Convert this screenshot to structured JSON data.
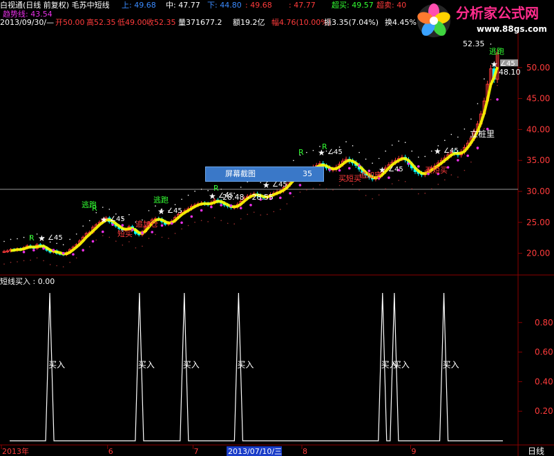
{
  "header": {
    "row1": [
      {
        "text": "白视通(日线 前复权) 毛苏中短线",
        "color": "#ffffff"
      },
      {
        "text": "上: 49.68",
        "color": "#3b8bff"
      },
      {
        "text": "中: 47.77",
        "color": "#ffffff"
      },
      {
        "text": "下: 44.80",
        "color": "#3b8bff"
      },
      {
        "text": ": 49.68",
        "color": "#ff3b3b"
      },
      {
        "text": ": 47.77",
        "color": "#ff3b3b"
      },
      {
        "text": "超买: 49.57",
        "color": "#33ff33"
      },
      {
        "text": "超卖: 40",
        "color": "#ff3b3b"
      }
    ],
    "trend_label": "趋势线: 43.54",
    "row2": [
      {
        "text": "2013/09/30/—",
        "color": "#ffffff"
      },
      {
        "text": "开50.00",
        "color": "#ff3b3b"
      },
      {
        "text": "高52.35",
        "color": "#ff3b3b"
      },
      {
        "text": "低49.00",
        "color": "#ff3b3b"
      },
      {
        "text": "收52.35",
        "color": "#ff3b3b"
      },
      {
        "text": "量371677.2",
        "color": "#ffffff"
      },
      {
        "text": "额19.2亿",
        "color": "#ffffff"
      },
      {
        "text": "幅4.76(10.00%)",
        "color": "#ff3b3b"
      },
      {
        "text": "振3.35(7.04%)",
        "color": "#ffffff"
      },
      {
        "text": "换4.45%",
        "color": "#ffffff"
      }
    ]
  },
  "logo": {
    "title": "分析家公式网",
    "url": "www.88gs.com"
  },
  "screenshot_button": {
    "label": "屏幕截图",
    "value": "35"
  },
  "annotations": {
    "price_range": "28.48 - 28.55",
    "high_label": "52.35",
    "side_label": "48.10",
    "stand_label": "立桩里",
    "angle_label": "45",
    "escape_label": "逃跑",
    "add_label": "追加仓",
    "short_buy_label": "短买",
    "buy_short_label": "买短买",
    "add_short_label": "追加空",
    "r_label": "R",
    "sub_title": "短线买入 : 0.00",
    "buy_label": "买入",
    "period_label": "日线"
  },
  "colors": {
    "up": "#ff3b3b",
    "down": "#00ffff",
    "ma_yellow": "#ffff00",
    "grid": "#8b0000",
    "pink": "#e830e8",
    "sub_line": "#ffffff",
    "axis_text": "#ff3b3b"
  },
  "chart_data": [
    {
      "type": "candlestick",
      "ylim": [
        16.5,
        56
      ],
      "yticks": [
        20.0,
        25.0,
        30.0,
        35.0,
        40.0,
        45.0,
        50.0
      ],
      "closes": [
        20.3,
        20.4,
        20.6,
        20.5,
        20.7,
        20.6,
        20.9,
        21.2,
        21.0,
        20.8,
        21.4,
        21.2,
        20.9,
        20.5,
        20.2,
        20.4,
        20.0,
        19.9,
        19.8,
        20.1,
        20.6,
        21.0,
        21.4,
        22.0,
        22.6,
        23.2,
        23.4,
        24.2,
        24.6,
        25.0,
        25.4,
        25.7,
        25.1,
        24.8,
        24.4,
        24.0,
        23.7,
        23.9,
        24.3,
        23.8,
        23.2,
        23.0,
        23.5,
        24.3,
        24.9,
        25.4,
        25.6,
        25.5,
        25.1,
        24.7,
        24.9,
        25.2,
        25.8,
        26.3,
        26.6,
        26.9,
        27.2,
        27.6,
        27.8,
        28.0,
        28.1,
        28.0,
        27.9,
        28.2,
        28.6,
        28.4,
        28.1,
        27.8,
        27.6,
        27.4,
        27.5,
        27.9,
        28.4,
        28.9,
        29.2,
        29.4,
        29.6,
        29.3,
        29.1,
        29.0,
        29.2,
        29.5,
        29.7,
        29.9,
        30.1,
        30.6,
        31.1,
        31.8,
        32.4,
        32.9,
        33.2,
        33.4,
        33.6,
        33.5,
        33.9,
        34.2,
        34.5,
        34.1,
        33.8,
        33.5,
        33.6,
        33.9,
        34.4,
        34.9,
        35.2,
        34.9,
        34.6,
        34.2,
        33.6,
        33.0,
        32.6,
        32.3,
        32.0,
        32.2,
        32.7,
        33.2,
        33.8,
        34.3,
        34.7,
        35.0,
        35.3,
        35.5,
        35.1,
        34.4,
        33.8,
        33.2,
        32.9,
        32.7,
        33.0,
        33.5,
        33.8,
        34.1,
        34.6,
        35.0,
        35.4,
        35.9,
        36.3,
        36.2,
        35.9,
        36.4,
        37.1,
        37.8,
        38.6,
        39.7,
        40.9,
        42.5,
        44.6,
        47.3,
        49.8,
        48.1,
        52.35
      ],
      "max_label": "52.35"
    },
    {
      "type": "line",
      "title": "短线买入 : 0.00",
      "ylim": [
        0,
        1
      ],
      "yticks": [
        0.2,
        0.4,
        0.6,
        0.8
      ],
      "spikes": [
        17,
        55,
        74,
        97,
        158,
        163,
        184
      ],
      "total_points": 210,
      "series": [
        {
          "values": "spike=1 at listed indices, 0 elsewhere"
        }
      ]
    }
  ],
  "xaxis": {
    "labels": [
      {
        "text": "2013年",
        "pos": 0.0
      },
      {
        "text": "6",
        "pos": 0.205
      },
      {
        "text": "7",
        "pos": 0.37
      },
      {
        "text": "8",
        "pos": 0.58
      },
      {
        "text": "9",
        "pos": 0.79
      }
    ],
    "highlight": "2013/07/10/三"
  }
}
